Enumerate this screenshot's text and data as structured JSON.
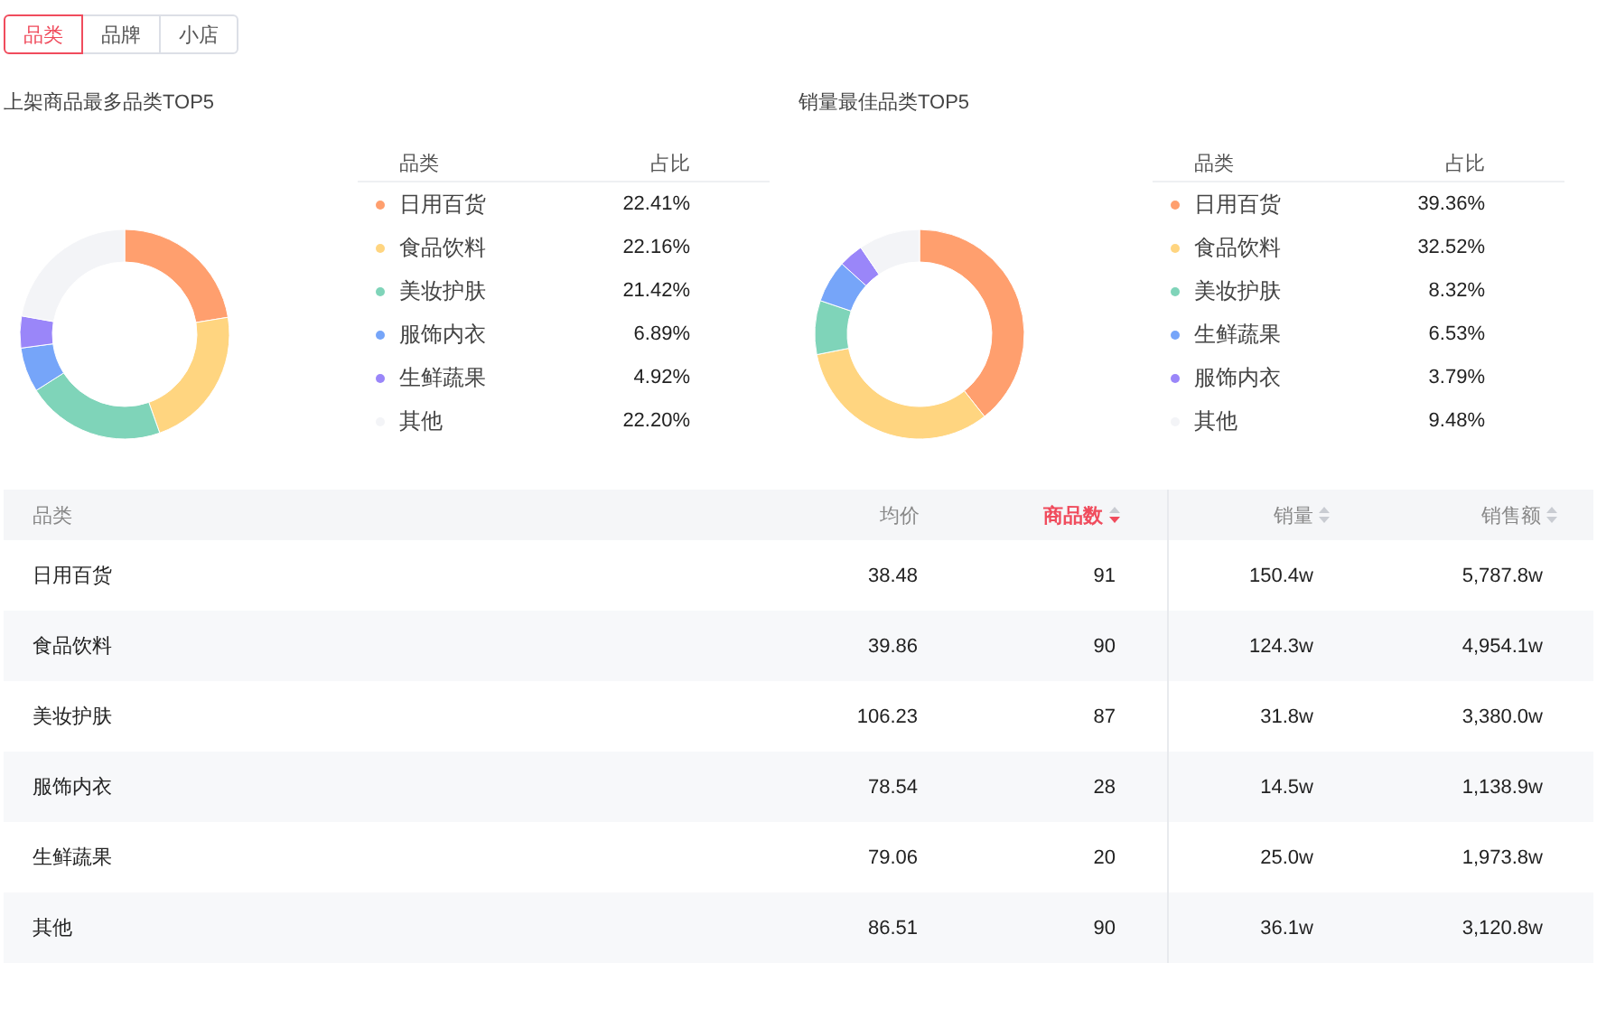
{
  "tabs": [
    {
      "label": "品类",
      "selected": true
    },
    {
      "label": "品牌",
      "selected": false
    },
    {
      "label": "小店",
      "selected": false
    }
  ],
  "panels": [
    {
      "chart_data": {
        "type": "donut",
        "title": "上架商品最多品类TOP5",
        "categories": [
          "日用百货",
          "食品饮料",
          "美妆护肤",
          "服饰内衣",
          "生鲜蔬果",
          "其他"
        ],
        "values": [
          22.41,
          22.16,
          21.42,
          6.89,
          4.92,
          22.2
        ]
      },
      "legend": {
        "columns": [
          "品类",
          "占比"
        ],
        "rows": [
          {
            "share": "22.41%",
            "color": "#ff9f6e"
          },
          {
            "share": "22.16%",
            "color": "#ffd580"
          },
          {
            "share": "21.42%",
            "color": "#7fd4b9"
          },
          {
            "share": "6.89%",
            "color": "#76a5f9"
          },
          {
            "share": "4.92%",
            "color": "#9a86f9"
          },
          {
            "share": "22.20%",
            "color": "#f3f4f7"
          }
        ]
      }
    },
    {
      "chart_data": {
        "type": "donut",
        "title": "销量最佳品类TOP5",
        "categories": [
          "日用百货",
          "食品饮料",
          "美妆护肤",
          "生鲜蔬果",
          "服饰内衣",
          "其他"
        ],
        "values": [
          39.36,
          32.52,
          8.32,
          6.53,
          3.79,
          9.48
        ]
      },
      "legend": {
        "columns": [
          "品类",
          "占比"
        ],
        "rows": [
          {
            "share": "39.36%",
            "color": "#ff9f6e"
          },
          {
            "share": "32.52%",
            "color": "#ffd580"
          },
          {
            "share": "8.32%",
            "color": "#7fd4b9"
          },
          {
            "share": "6.53%",
            "color": "#76a5f9"
          },
          {
            "share": "3.79%",
            "color": "#9a86f9"
          },
          {
            "share": "9.48%",
            "color": "#f3f4f7"
          }
        ]
      }
    }
  ],
  "table": {
    "columns": [
      {
        "label": "品类",
        "sortable": false,
        "sorted": false
      },
      {
        "label": "均价",
        "sortable": false,
        "sorted": false
      },
      {
        "label": "商品数",
        "sortable": true,
        "sorted": true
      },
      {
        "label": "销量",
        "sortable": true,
        "sorted": false
      },
      {
        "label": "销售额",
        "sortable": true,
        "sorted": false
      }
    ],
    "rows": [
      [
        "日用百货",
        "38.48",
        "91",
        "150.4w",
        "5,787.8w"
      ],
      [
        "食品饮料",
        "39.86",
        "90",
        "124.3w",
        "4,954.1w"
      ],
      [
        "美妆护肤",
        "106.23",
        "87",
        "31.8w",
        "3,380.0w"
      ],
      [
        "服饰内衣",
        "78.54",
        "28",
        "14.5w",
        "1,138.9w"
      ],
      [
        "生鲜蔬果",
        "79.06",
        "20",
        "25.0w",
        "1,973.8w"
      ],
      [
        "其他",
        "86.51",
        "90",
        "36.1w",
        "3,120.8w"
      ]
    ]
  }
}
